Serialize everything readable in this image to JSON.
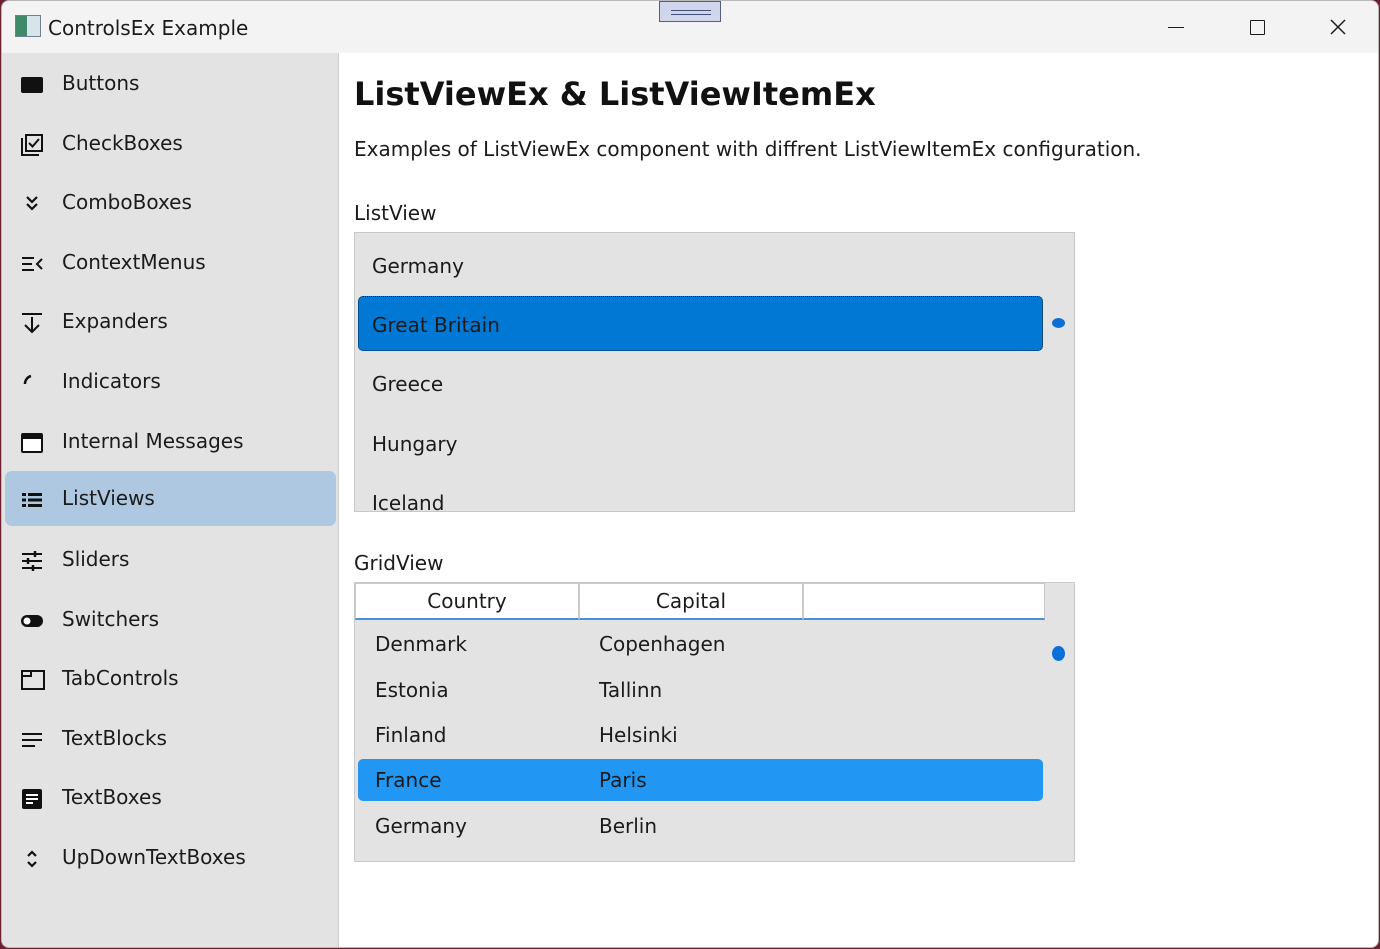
{
  "window": {
    "title": "ControlsEx Example"
  },
  "sidebar": {
    "items": [
      {
        "label": "Buttons",
        "icon": "button-icon"
      },
      {
        "label": "CheckBoxes",
        "icon": "checkbox-icon"
      },
      {
        "label": "ComboBoxes",
        "icon": "double-chevron-down-icon"
      },
      {
        "label": "ContextMenus",
        "icon": "context-menu-icon"
      },
      {
        "label": "Expanders",
        "icon": "expander-icon"
      },
      {
        "label": "Indicators",
        "icon": "progress-ring-icon"
      },
      {
        "label": "Internal Messages",
        "icon": "message-window-icon"
      },
      {
        "label": "ListViews",
        "icon": "list-icon",
        "active": true
      },
      {
        "label": "Sliders",
        "icon": "sliders-icon"
      },
      {
        "label": "Switchers",
        "icon": "toggle-switch-icon"
      },
      {
        "label": "TabControls",
        "icon": "tab-icon"
      },
      {
        "label": "TextBlocks",
        "icon": "text-lines-icon"
      },
      {
        "label": "TextBoxes",
        "icon": "text-box-icon"
      },
      {
        "label": "UpDownTextBoxes",
        "icon": "up-down-chevron-icon"
      }
    ]
  },
  "main": {
    "title": "ListViewEx & ListViewItemEx",
    "description": "Examples of ListViewEx component with diffrent ListViewItemEx configuration.",
    "listview": {
      "label": "ListView",
      "items": [
        "Germany",
        "Great Britain",
        "Greece",
        "Hungary",
        "Iceland"
      ],
      "selected": "Great Britain"
    },
    "gridview": {
      "label": "GridView",
      "columns": [
        "Country",
        "Capital",
        ""
      ],
      "rows": [
        {
          "country": "Denmark",
          "capital": "Copenhagen"
        },
        {
          "country": "Estonia",
          "capital": "Tallinn"
        },
        {
          "country": "Finland",
          "capital": "Helsinki"
        },
        {
          "country": "France",
          "capital": "Paris"
        },
        {
          "country": "Germany",
          "capital": "Berlin"
        }
      ],
      "selected": "France"
    }
  },
  "colors": {
    "accent": "#0078d4",
    "grid_selection": "#2196f3",
    "sidebar_active": "#adc8e0",
    "sidebar_bg": "#e3e3e3"
  }
}
